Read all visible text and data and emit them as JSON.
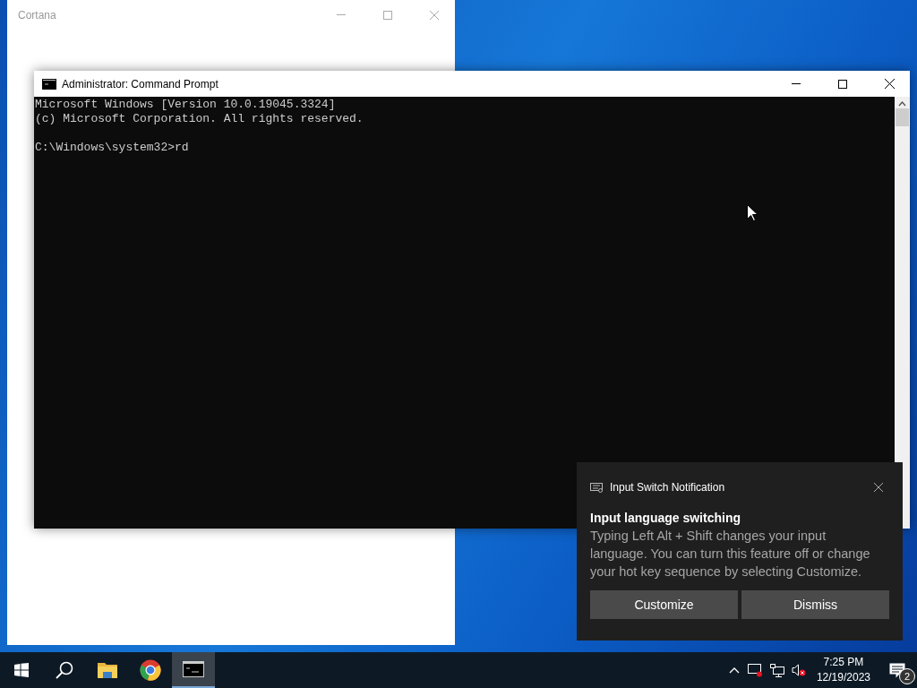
{
  "background_window": {
    "title": "Cortana"
  },
  "console_window": {
    "title": "Administrator: Command Prompt",
    "paragraphs": [
      [
        "Microsoft Windows [Version 10.0.19045.3324]",
        "(c) Microsoft Corporation. All rights reserved."
      ],
      [
        "C:\\Windows\\system32>rd"
      ]
    ]
  },
  "notification": {
    "app": "Input Switch Notification",
    "title": "Input language switching",
    "body": "Typing Left Alt + Shift changes your input language. You can turn this feature off or change your hot key sequence by selecting Customize.",
    "buttons": [
      "Customize",
      "Dismiss"
    ]
  },
  "taskbar": {
    "apps": [
      {
        "kind": "start",
        "selected": false
      },
      {
        "kind": "search",
        "selected": false
      },
      {
        "kind": "folder",
        "selected": false
      },
      {
        "kind": "browser",
        "selected": false
      },
      {
        "kind": "console",
        "selected": true
      }
    ],
    "time": "7:25 PM",
    "date": "12/19/2023",
    "notification_count": "2"
  }
}
